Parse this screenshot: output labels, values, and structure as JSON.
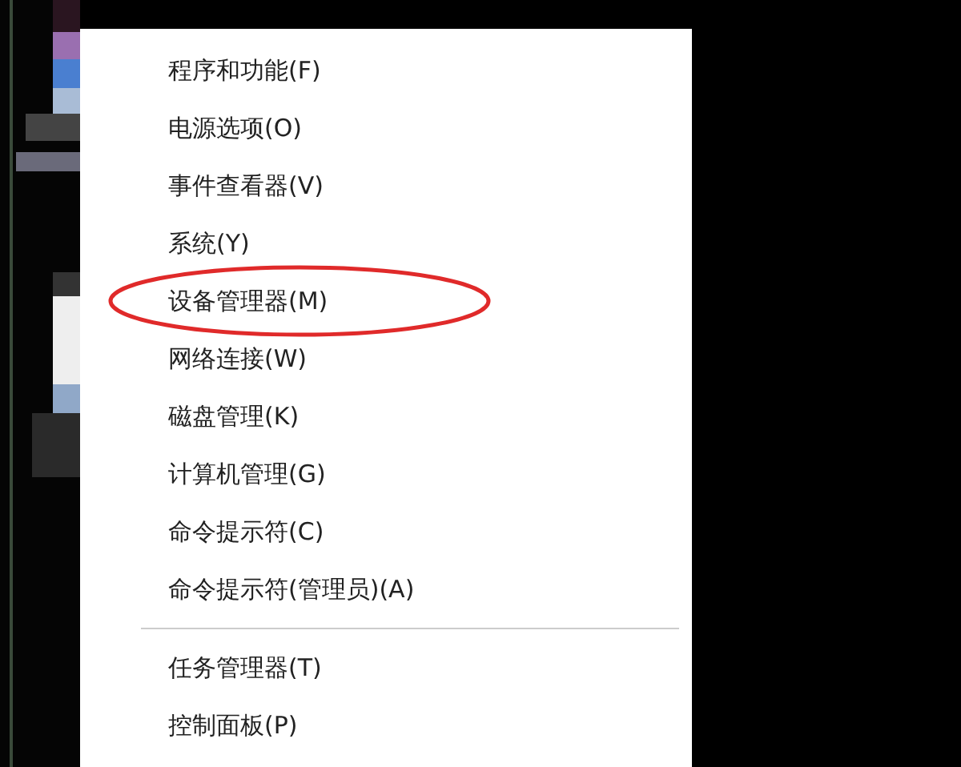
{
  "menu": {
    "groups": [
      {
        "items": [
          {
            "label": "程序和功能(F)",
            "circled": false
          },
          {
            "label": "电源选项(O)",
            "circled": false
          },
          {
            "label": "事件查看器(V)",
            "circled": false
          },
          {
            "label": "系统(Y)",
            "circled": false
          },
          {
            "label": "设备管理器(M)",
            "circled": true
          },
          {
            "label": "网络连接(W)",
            "circled": false
          },
          {
            "label": "磁盘管理(K)",
            "circled": false
          },
          {
            "label": "计算机管理(G)",
            "circled": false
          },
          {
            "label": "命令提示符(C)",
            "circled": false
          },
          {
            "label": "命令提示符(管理员)(A)",
            "circled": false
          }
        ]
      },
      {
        "items": [
          {
            "label": "任务管理器(T)",
            "circled": false
          },
          {
            "label": "控制面板(P)",
            "circled": false
          }
        ]
      }
    ]
  }
}
